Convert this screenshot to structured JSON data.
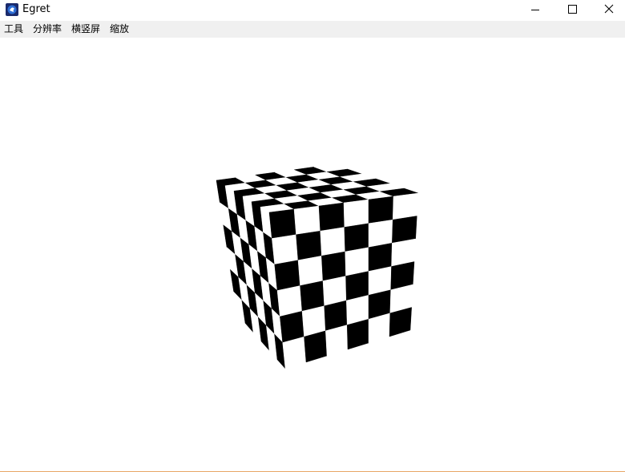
{
  "window": {
    "title": "Egret",
    "controls": {
      "minimize": "minimize-icon",
      "maximize": "maximize-icon",
      "close": "close-icon"
    }
  },
  "menu": {
    "items": [
      {
        "label": "工具"
      },
      {
        "label": "分辨率"
      },
      {
        "label": "横竖屏"
      },
      {
        "label": "缩放"
      }
    ]
  },
  "scene": {
    "object": "checkerboard-cube",
    "grid_per_face": 6,
    "colors": {
      "dark": "#000000",
      "light": "#ffffff",
      "accent_border": "#e8a766"
    }
  }
}
